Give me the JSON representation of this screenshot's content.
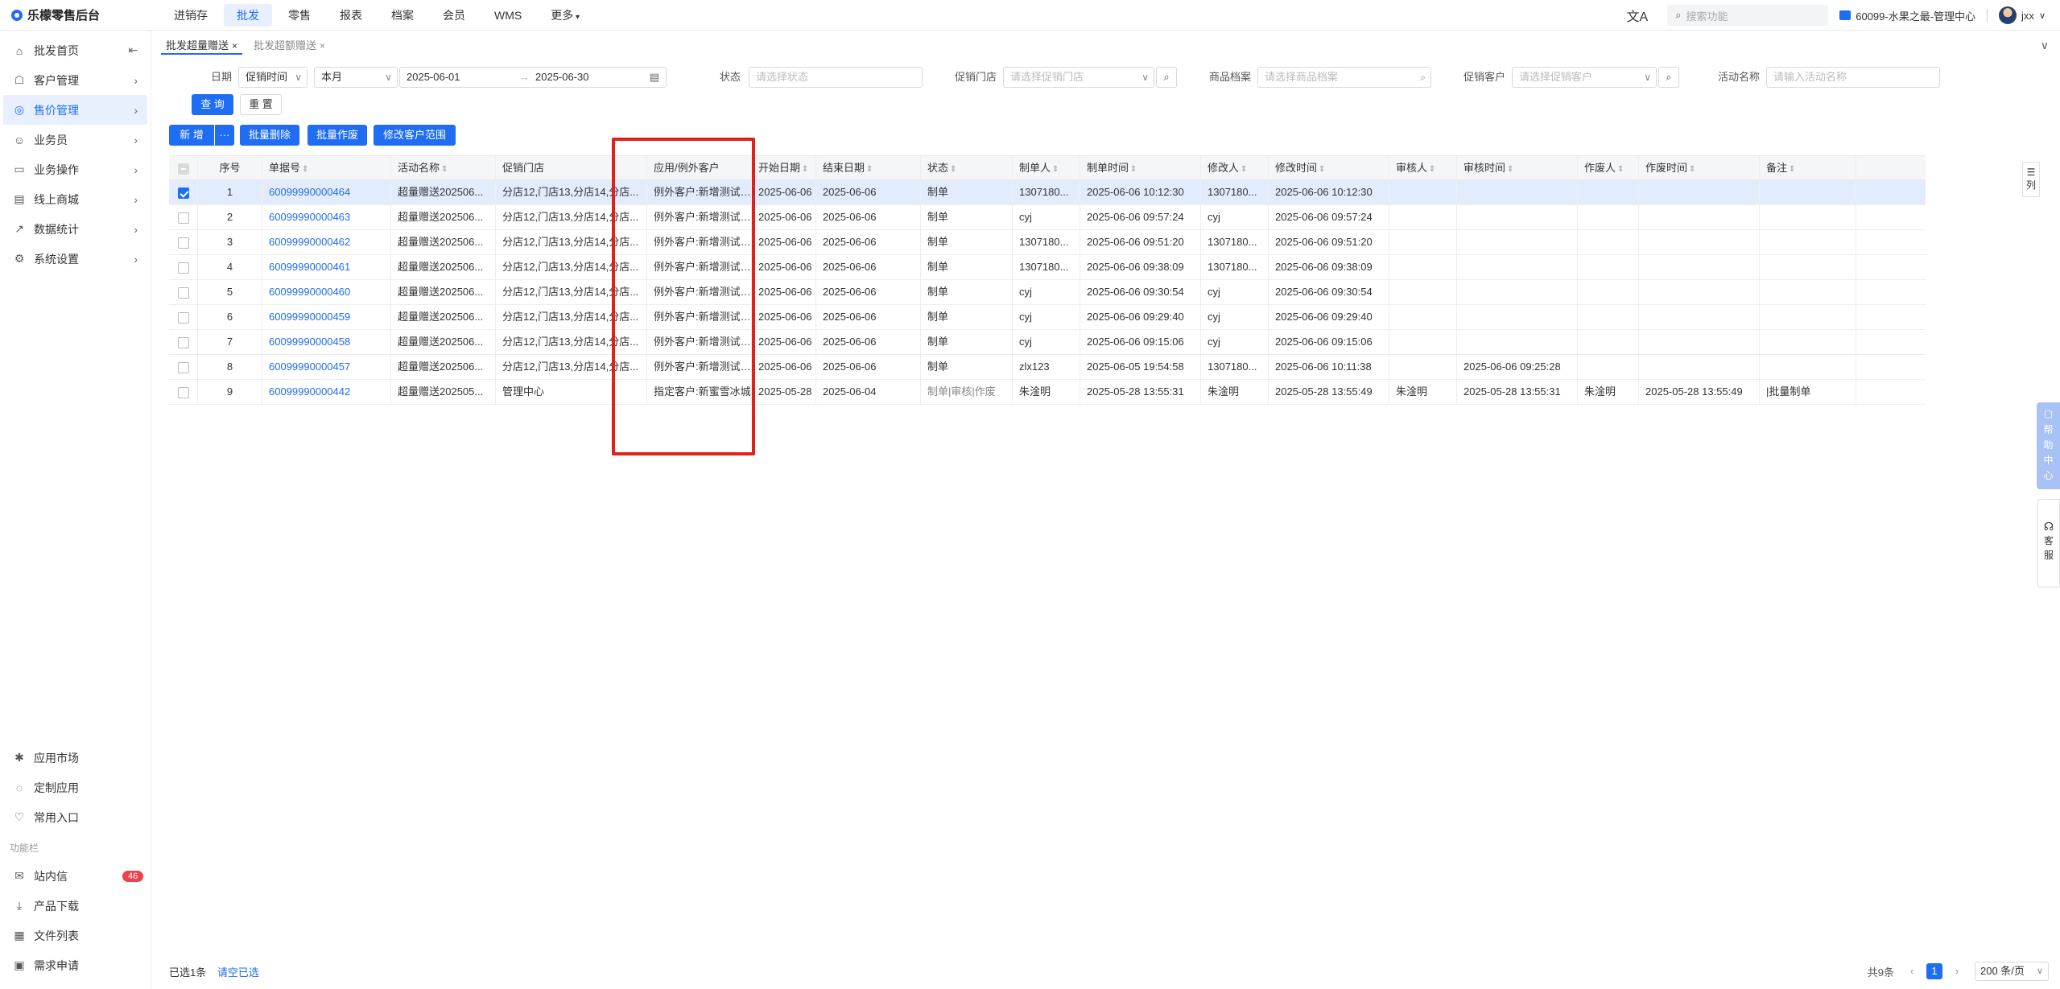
{
  "app": {
    "title": "乐檬零售后台"
  },
  "topnav": [
    "进销存",
    "批发",
    "零售",
    "报表",
    "档案",
    "会员",
    "WMS",
    "更多"
  ],
  "topnav_active": 1,
  "header": {
    "search_placeholder": "搜索功能",
    "store": "60099-水果之最-管理中心",
    "user": "jxx"
  },
  "sidebar": {
    "items": [
      {
        "label": "批发首页",
        "icon": "home-icon"
      },
      {
        "label": "客户管理",
        "icon": "customer-icon"
      },
      {
        "label": "售价管理",
        "icon": "price-icon"
      },
      {
        "label": "业务员",
        "icon": "salesman-icon"
      },
      {
        "label": "业务操作",
        "icon": "operation-icon"
      },
      {
        "label": "线上商城",
        "icon": "mall-icon"
      },
      {
        "label": "数据统计",
        "icon": "stats-icon"
      },
      {
        "label": "系统设置",
        "icon": "settings-icon"
      }
    ],
    "active": 2,
    "bottom_items": [
      {
        "label": "应用市场",
        "icon": "app-market-icon"
      },
      {
        "label": "定制应用",
        "icon": "custom-app-icon"
      },
      {
        "label": "常用入口",
        "icon": "heart-icon"
      }
    ],
    "section_label": "功能栏",
    "func_items": [
      {
        "label": "站内信",
        "icon": "message-icon",
        "badge": "46"
      },
      {
        "label": "产品下载",
        "icon": "download-icon"
      },
      {
        "label": "文件列表",
        "icon": "file-list-icon"
      },
      {
        "label": "需求申请",
        "icon": "request-icon"
      }
    ]
  },
  "tabs": [
    {
      "label": "批发超量赠送",
      "active": true
    },
    {
      "label": "批发超额赠送",
      "active": false
    }
  ],
  "filters": {
    "date_label": "日期",
    "date_type": "促销时间",
    "date_range_type": "本月",
    "date_start": "2025-06-01",
    "date_end": "2025-06-30",
    "status_label": "状态",
    "status_placeholder": "请选择状态",
    "store_label": "促销门店",
    "store_placeholder": "请选择促销门店",
    "goods_label": "商品档案",
    "goods_placeholder": "请选择商品档案",
    "customer_label": "促销客户",
    "customer_placeholder": "请选择促销客户",
    "activity_label": "活动名称",
    "activity_placeholder": "请输入活动名称"
  },
  "buttons": {
    "query": "查 询",
    "reset": "重 置",
    "add": "新 增",
    "more": "···",
    "batch_delete": "批量删除",
    "batch_void": "批量作废",
    "modify_customer": "修改客户范围"
  },
  "table": {
    "columns": [
      "序号",
      "单据号",
      "活动名称",
      "促销门店",
      "应用/例外客户",
      "开始日期",
      "结束日期",
      "状态",
      "制单人",
      "制单时间",
      "修改人",
      "修改时间",
      "审核人",
      "审核时间",
      "作废人",
      "作废时间",
      "备注"
    ],
    "rows": [
      [
        "1",
        "60099990000464",
        "超量赠送202506...",
        "分店12,门店13,分店14,分店...",
        "例外客户:新增测试0113, 客...",
        "2025-06-06",
        "2025-06-06",
        "制单",
        "1307180...",
        "2025-06-06 10:12:30",
        "1307180...",
        "2025-06-06 10:12:30",
        "",
        "",
        "",
        "",
        ""
      ],
      [
        "2",
        "60099990000463",
        "超量赠送202506...",
        "分店12,门店13,分店14,分店...",
        "例外客户:新增测试0113, 客...",
        "2025-06-06",
        "2025-06-06",
        "制单",
        "cyj",
        "2025-06-06 09:57:24",
        "cyj",
        "2025-06-06 09:57:24",
        "",
        "",
        "",
        "",
        ""
      ],
      [
        "3",
        "60099990000462",
        "超量赠送202506...",
        "分店12,门店13,分店14,分店...",
        "例外客户:新增测试0113, 客...",
        "2025-06-06",
        "2025-06-06",
        "制单",
        "1307180...",
        "2025-06-06 09:51:20",
        "1307180...",
        "2025-06-06 09:51:20",
        "",
        "",
        "",
        "",
        ""
      ],
      [
        "4",
        "60099990000461",
        "超量赠送202506...",
        "分店12,门店13,分店14,分店...",
        "例外客户:新增测试0113, 客...",
        "2025-06-06",
        "2025-06-06",
        "制单",
        "1307180...",
        "2025-06-06 09:38:09",
        "1307180...",
        "2025-06-06 09:38:09",
        "",
        "",
        "",
        "",
        ""
      ],
      [
        "5",
        "60099990000460",
        "超量赠送202506...",
        "分店12,门店13,分店14,分店...",
        "例外客户:新增测试0113, 客...",
        "2025-06-06",
        "2025-06-06",
        "制单",
        "cyj",
        "2025-06-06 09:30:54",
        "cyj",
        "2025-06-06 09:30:54",
        "",
        "",
        "",
        "",
        ""
      ],
      [
        "6",
        "60099990000459",
        "超量赠送202506...",
        "分店12,门店13,分店14,分店...",
        "例外客户:新增测试0113, 客...",
        "2025-06-06",
        "2025-06-06",
        "制单",
        "cyj",
        "2025-06-06 09:29:40",
        "cyj",
        "2025-06-06 09:29:40",
        "",
        "",
        "",
        "",
        ""
      ],
      [
        "7",
        "60099990000458",
        "超量赠送202506...",
        "分店12,门店13,分店14,分店...",
        "例外客户:新增测试0113, 客...",
        "2025-06-06",
        "2025-06-06",
        "制单",
        "cyj",
        "2025-06-06 09:15:06",
        "cyj",
        "2025-06-06 09:15:06",
        "",
        "",
        "",
        "",
        ""
      ],
      [
        "8",
        "60099990000457",
        "超量赠送202506...",
        "分店12,门店13,分店14,分店...",
        "例外客户:新增测试0113, 客...",
        "2025-06-06",
        "2025-06-06",
        "制单",
        "zlx123",
        "2025-06-05 19:54:58",
        "1307180...",
        "2025-06-06 10:11:38",
        "",
        "2025-06-06 09:25:28",
        "",
        "",
        ""
      ],
      [
        "9",
        "60099990000442",
        "超量赠送202505...",
        "管理中心",
        "指定客户:新蜜雪冰城",
        "2025-05-28",
        "2025-06-04",
        "制单|审核|作废",
        "朱淦明",
        "2025-05-28 13:55:31",
        "朱淦明",
        "2025-05-28 13:55:49",
        "朱淦明",
        "2025-05-28 13:55:31",
        "朱淦明",
        "2025-05-28 13:55:49",
        "|批量制单"
      ]
    ]
  },
  "right_panel": {
    "column_toggle": "列",
    "help_center": "帮助中心",
    "service": "客服"
  },
  "footer": {
    "selected": "已选1条",
    "clear": "请空已选",
    "total": "共9条",
    "page": "1",
    "page_size": "200 条/页"
  }
}
